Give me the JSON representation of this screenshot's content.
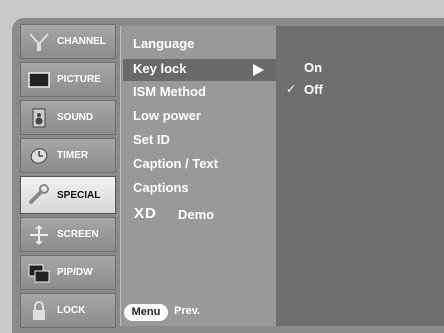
{
  "sidebar": {
    "items": [
      {
        "label": "CHANNEL",
        "icon": "antenna-icon"
      },
      {
        "label": "PICTURE",
        "icon": "tv-screen-icon"
      },
      {
        "label": "SOUND",
        "icon": "speaker-icon"
      },
      {
        "label": "TIMER",
        "icon": "clock-icon"
      },
      {
        "label": "SPECIAL",
        "icon": "special-wrench-icon",
        "active": true
      },
      {
        "label": "SCREEN",
        "icon": "screen-adjust-icon"
      },
      {
        "label": "PIP/DW",
        "icon": "pip-icon"
      },
      {
        "label": "LOCK",
        "icon": "padlock-icon"
      }
    ]
  },
  "submenu": {
    "items": [
      "Language",
      "Key lock",
      "ISM Method",
      "Low power",
      "Set ID",
      "Caption / Text",
      "Captions"
    ],
    "selected": "Key lock",
    "xd_logo": "XD",
    "xd_demo": "Demo"
  },
  "options": {
    "items": [
      "On",
      "Off"
    ],
    "checked": "Off"
  },
  "footer": {
    "menu_button": "Menu",
    "prev_label": "Prev."
  }
}
